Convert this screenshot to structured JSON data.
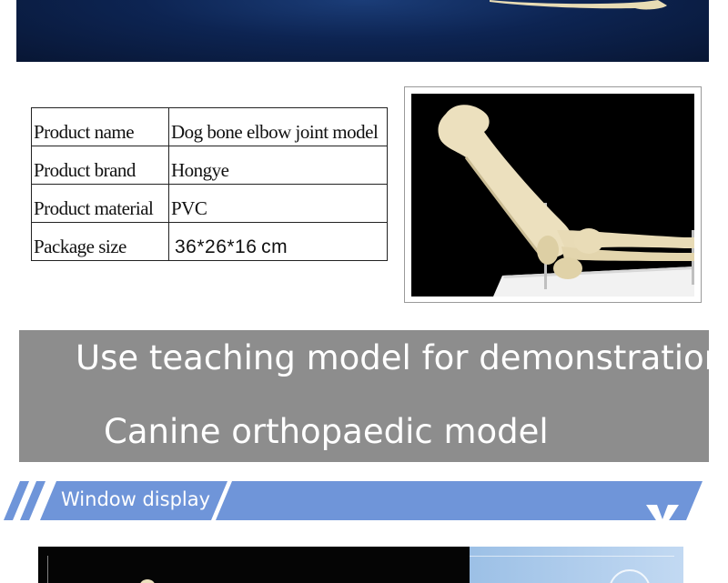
{
  "specs": [
    {
      "label": "Product name",
      "value": "Dog bone elbow joint model"
    },
    {
      "label": "Product brand",
      "value": "Hongye"
    },
    {
      "label": "Product material",
      "value": "PVC"
    },
    {
      "label": "Package size",
      "value": "36*26*16 cm"
    }
  ],
  "banner": {
    "line1": "Use teaching model for demonstration",
    "line2": "Canine orthopaedic model"
  },
  "section": {
    "title": "Window display"
  },
  "colors": {
    "header_blue": "#6f95d9",
    "gray_band": "#8d8d8d",
    "navy": "#0d2452"
  }
}
